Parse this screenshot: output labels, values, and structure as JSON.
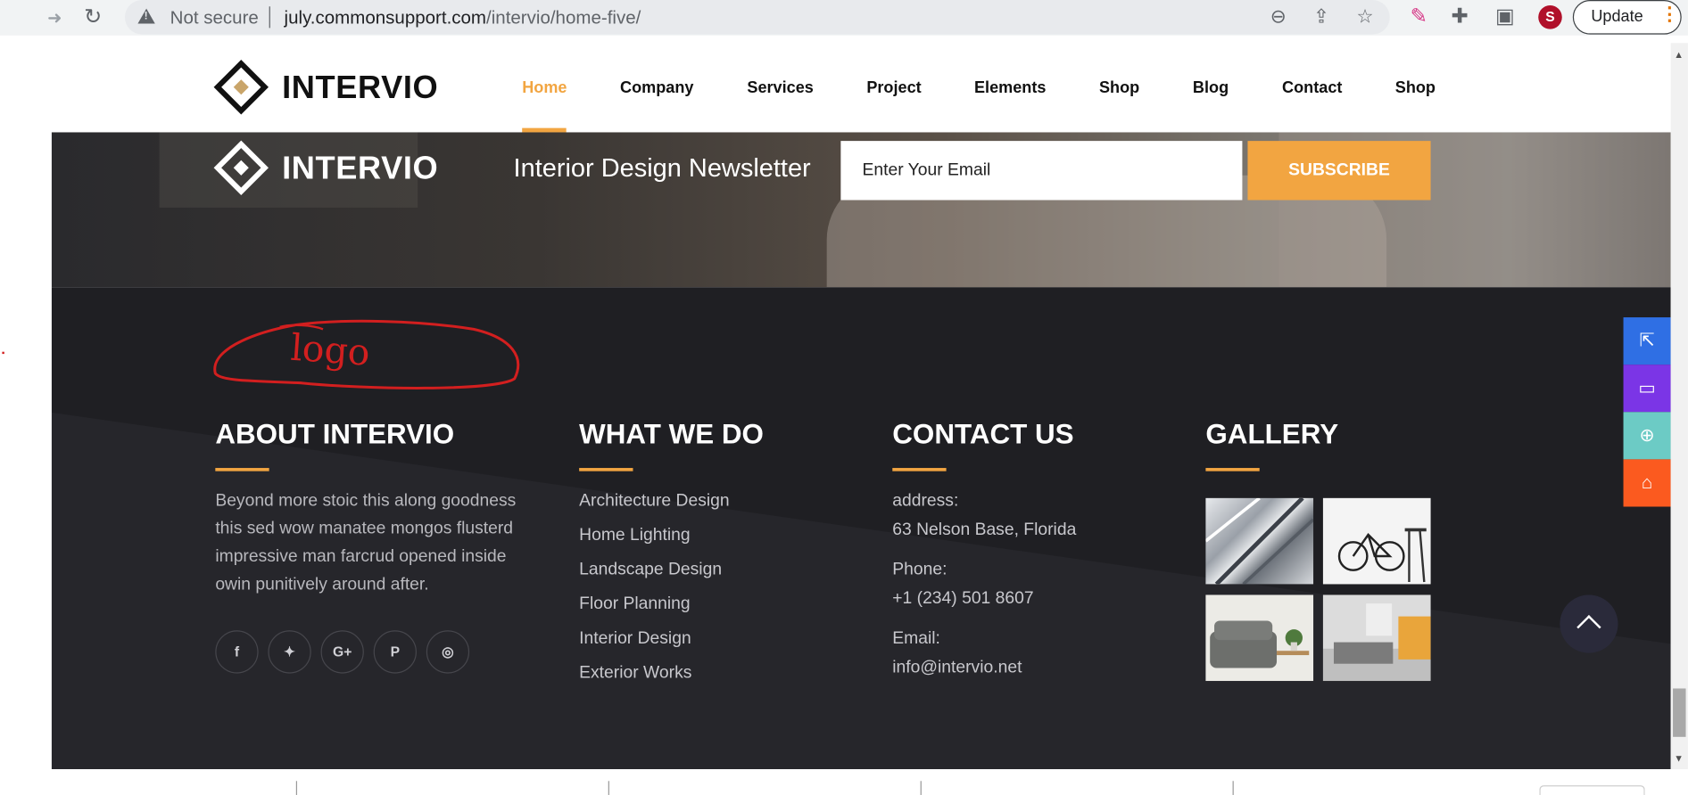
{
  "browser": {
    "not_secure": "Not secure",
    "url_domain": "july.commonsupport.com",
    "url_path": "/intervio/home-five/",
    "update_label": "Update",
    "icons": [
      "zoom-icon",
      "share-icon",
      "star-icon",
      "color-picker-icon",
      "puzzle-icon",
      "sidepanel-icon",
      "profile-icon"
    ]
  },
  "header": {
    "logo_text": "INTERVIO",
    "nav": [
      {
        "label": "Home",
        "active": true
      },
      {
        "label": "Company"
      },
      {
        "label": "Services"
      },
      {
        "label": "Project"
      },
      {
        "label": "Elements"
      },
      {
        "label": "Shop"
      },
      {
        "label": "Blog"
      },
      {
        "label": "Contact"
      },
      {
        "label": "Shop"
      }
    ]
  },
  "newsletter": {
    "logo_text": "INTERVIO",
    "title": "Interior Design Newsletter",
    "email_placeholder": "Enter Your Email",
    "subscribe_label": "SUBSCRIBE"
  },
  "annotation": {
    "text": "logo"
  },
  "footer": {
    "about": {
      "title": "ABOUT INTERVIO",
      "text": "Beyond more stoic this along goodness this sed wow manatee mongos flusterd impressive man farcrud opened inside owin punitively around after.",
      "social": [
        {
          "icon": "facebook-icon",
          "glyph": "f"
        },
        {
          "icon": "twitter-icon",
          "glyph": "🐦"
        },
        {
          "icon": "google-plus-icon",
          "glyph": "G+"
        },
        {
          "icon": "pinterest-icon",
          "glyph": "P"
        },
        {
          "icon": "instagram-icon",
          "glyph": "◎"
        }
      ]
    },
    "what_we_do": {
      "title": "WHAT WE DO",
      "links": [
        "Architecture Design",
        "Home Lighting",
        "Landscape Design",
        "Floor Planning",
        "Interior Design",
        "Exterior Works"
      ]
    },
    "contact": {
      "title": "CONTACT US",
      "address_label": "address:",
      "address": "63 Nelson Base, Florida",
      "phone_label": "Phone:",
      "phone": "+1 (234) 501 8607",
      "email_label": "Email:",
      "email": "info@intervio.net"
    },
    "gallery": {
      "title": "GALLERY",
      "images": [
        "gallery-architecture-thumb",
        "gallery-bicycle-thumb",
        "gallery-sofa-thumb",
        "gallery-interior-thumb"
      ]
    }
  },
  "side_buttons": [
    {
      "icon": "external-link-icon",
      "color": "#2f6fe4"
    },
    {
      "icon": "monitor-icon",
      "color": "#7b35e6"
    },
    {
      "icon": "lifebuoy-icon",
      "color": "#6ccbc5"
    },
    {
      "icon": "basket-icon",
      "color": "#fb5a1f"
    }
  ],
  "colors": {
    "accent": "#f2a541",
    "footer_bg": "#1f1f23"
  }
}
